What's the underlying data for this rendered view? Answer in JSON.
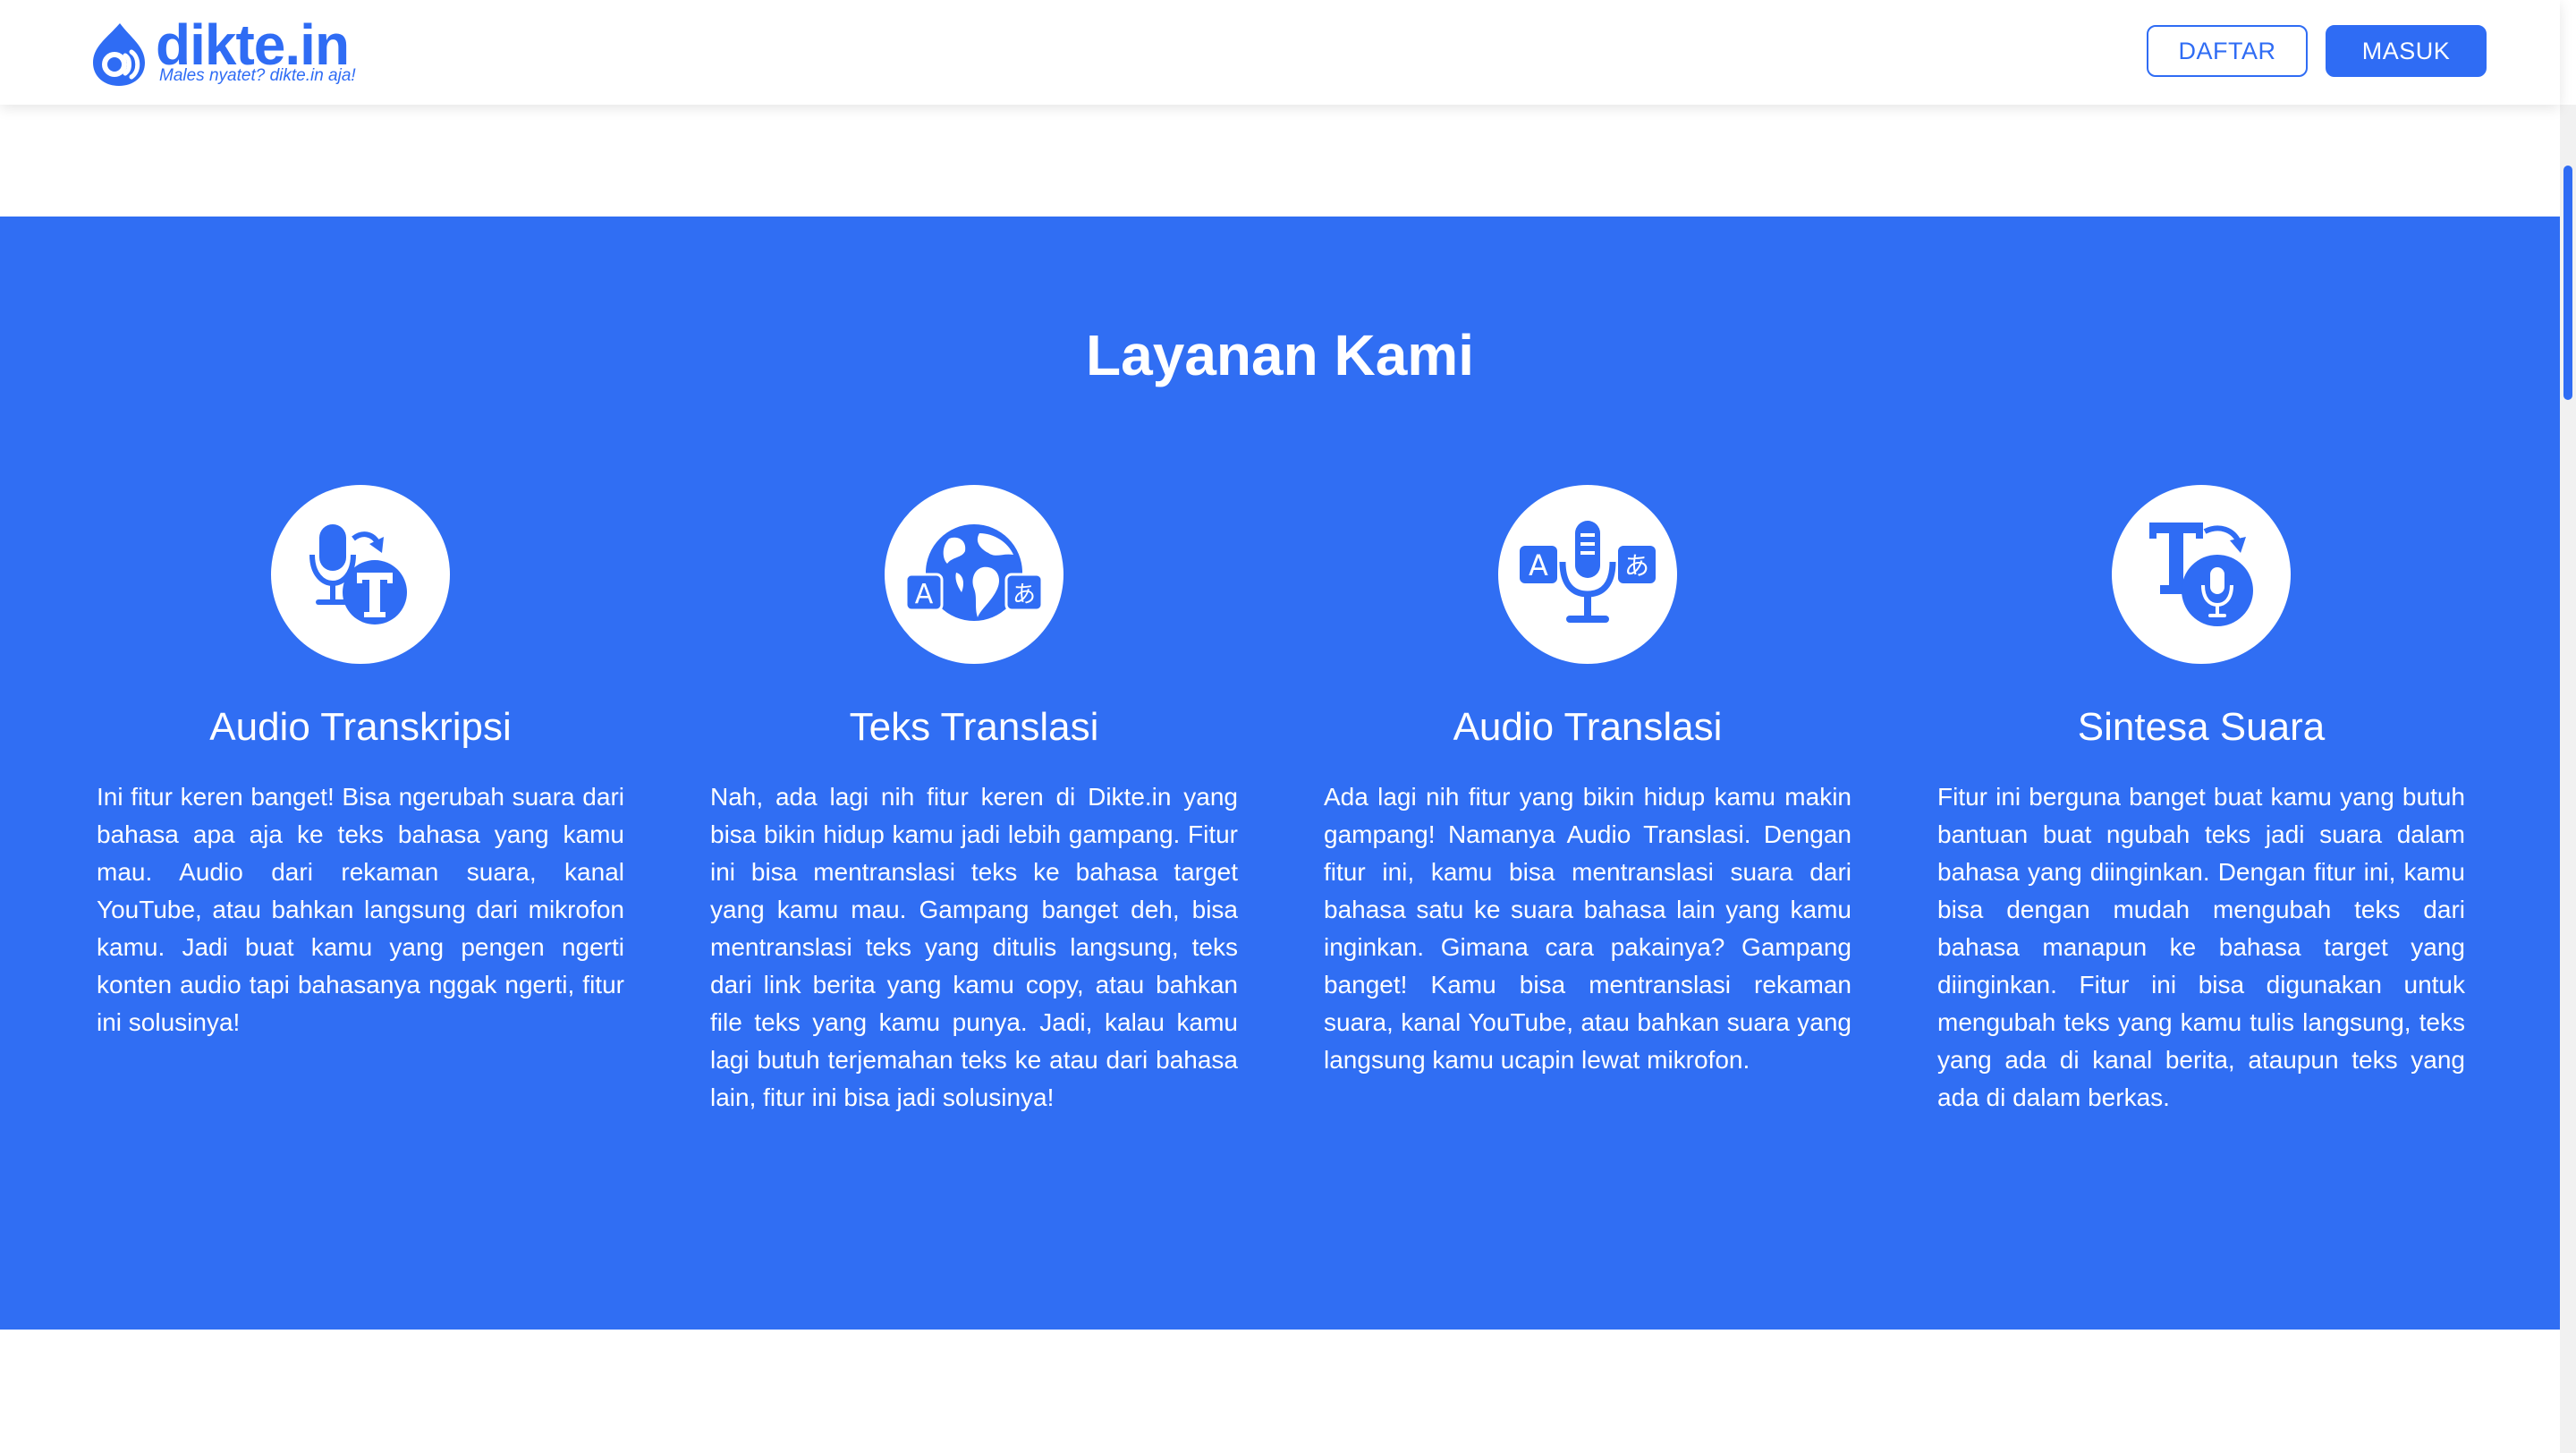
{
  "brand": {
    "name": "dikte.in",
    "tagline": "Males nyatet? dikte.in aja!",
    "color": "#2f6cf4"
  },
  "header": {
    "register_label": "DAFTAR",
    "login_label": "MASUK"
  },
  "services": {
    "title": "Layanan Kami",
    "background": "#306ef3",
    "items": [
      {
        "icon": "audio-transcription-icon",
        "title": "Audio Transkripsi",
        "description": "Ini fitur keren banget! Bisa ngerubah suara dari bahasa apa aja ke teks bahasa yang kamu mau. Audio dari rekaman suara, kanal YouTube, atau bahkan langsung dari mikrofon kamu. Jadi buat kamu yang pengen ngerti konten audio tapi bahasanya nggak ngerti, fitur ini solusinya!"
      },
      {
        "icon": "text-translation-globe-icon",
        "title": "Teks Translasi",
        "description": "Nah, ada lagi nih fitur keren di Dikte.in yang bisa bikin hidup kamu jadi lebih gampang. Fitur ini bisa mentranslasi teks ke bahasa target yang kamu mau. Gampang banget deh, bisa mentranslasi teks yang ditulis langsung, teks dari link berita yang kamu copy, atau bahkan file teks yang kamu punya. Jadi, kalau kamu lagi butuh terjemahan teks ke atau dari bahasa lain, fitur ini bisa jadi solusinya!"
      },
      {
        "icon": "audio-translation-icon",
        "title": "Audio Translasi",
        "description": "Ada lagi nih fitur yang bikin hidup kamu makin gampang! Namanya Audio Translasi. Dengan fitur ini, kamu bisa mentranslasi suara dari bahasa satu ke suara bahasa lain yang kamu inginkan. Gimana cara pakainya? Gampang banget! Kamu bisa mentranslasi rekaman suara, kanal YouTube, atau bahkan suara yang langsung kamu ucapin lewat mikrofon."
      },
      {
        "icon": "speech-synthesis-icon",
        "title": "Sintesa Suara",
        "description": "Fitur ini berguna banget buat kamu yang butuh bantuan buat ngubah teks jadi suara dalam bahasa yang diinginkan. Dengan fitur ini, kamu bisa dengan mudah mengubah teks dari bahasa manapun ke bahasa target yang diinginkan. Fitur ini bisa digunakan untuk mengubah teks yang kamu tulis langsung, teks yang ada di kanal berita, ataupun teks yang ada di dalam berkas."
      }
    ]
  }
}
